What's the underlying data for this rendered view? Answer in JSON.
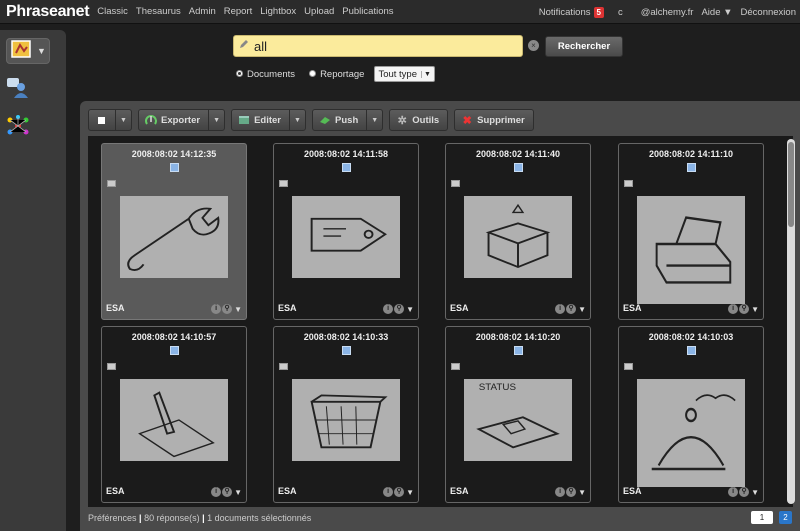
{
  "app": {
    "name": "Phraseanet"
  },
  "topnav": [
    "Classic",
    "Thesaurus",
    "Admin",
    "Report",
    "Lightbox",
    "Upload",
    "Publications"
  ],
  "topright": {
    "notifications_label": "Notifications",
    "notifications_count": "5",
    "user_initial": "c",
    "account": "@alchemy.fr",
    "help": "Aide ▼",
    "logout": "Déconnexion"
  },
  "sidebar": {
    "icons": [
      "basket-icon",
      "users-icon",
      "thesaurus-icon"
    ]
  },
  "search": {
    "value": "all",
    "button_label": "Rechercher",
    "option_documents": "Documents",
    "option_reportage": "Reportage",
    "selected_option": "Documents",
    "type_select": "Tout type"
  },
  "toolbar": {
    "exporter": "Exporter",
    "editer": "Editer",
    "push": "Push",
    "outils": "Outils",
    "supprimer": "Supprimer"
  },
  "results": [
    {
      "date": "2008:08:02 14:12:35",
      "collection": "ESA",
      "selected": true,
      "sketch": "wrench"
    },
    {
      "date": "2008:08:02 14:11:58",
      "collection": "ESA",
      "selected": false,
      "sketch": "tag"
    },
    {
      "date": "2008:08:02 14:11:40",
      "collection": "ESA",
      "selected": false,
      "sketch": "box"
    },
    {
      "date": "2008:08:02 14:11:10",
      "collection": "ESA",
      "selected": false,
      "sketch": "printer"
    },
    {
      "date": "2008:08:02 14:10:57",
      "collection": "ESA",
      "selected": false,
      "sketch": "pen"
    },
    {
      "date": "2008:08:02 14:10:33",
      "collection": "ESA",
      "selected": false,
      "sketch": "basket"
    },
    {
      "date": "2008:08:02 14:10:20",
      "collection": "ESA",
      "selected": false,
      "sketch": "status",
      "sketch_text": "STATUS"
    },
    {
      "date": "2008:08:02 14:10:03",
      "collection": "ESA",
      "selected": false,
      "sketch": "dish"
    }
  ],
  "status": {
    "preferences": "Préférences",
    "responses": "80 réponse(s)",
    "selected": "1 documents sélectionnés"
  },
  "pager": {
    "current": "1",
    "next": "2"
  },
  "colors": {
    "search_bg": "#fbeb9c",
    "badge": "#dd3333",
    "accent_blue": "#2a76c9"
  }
}
